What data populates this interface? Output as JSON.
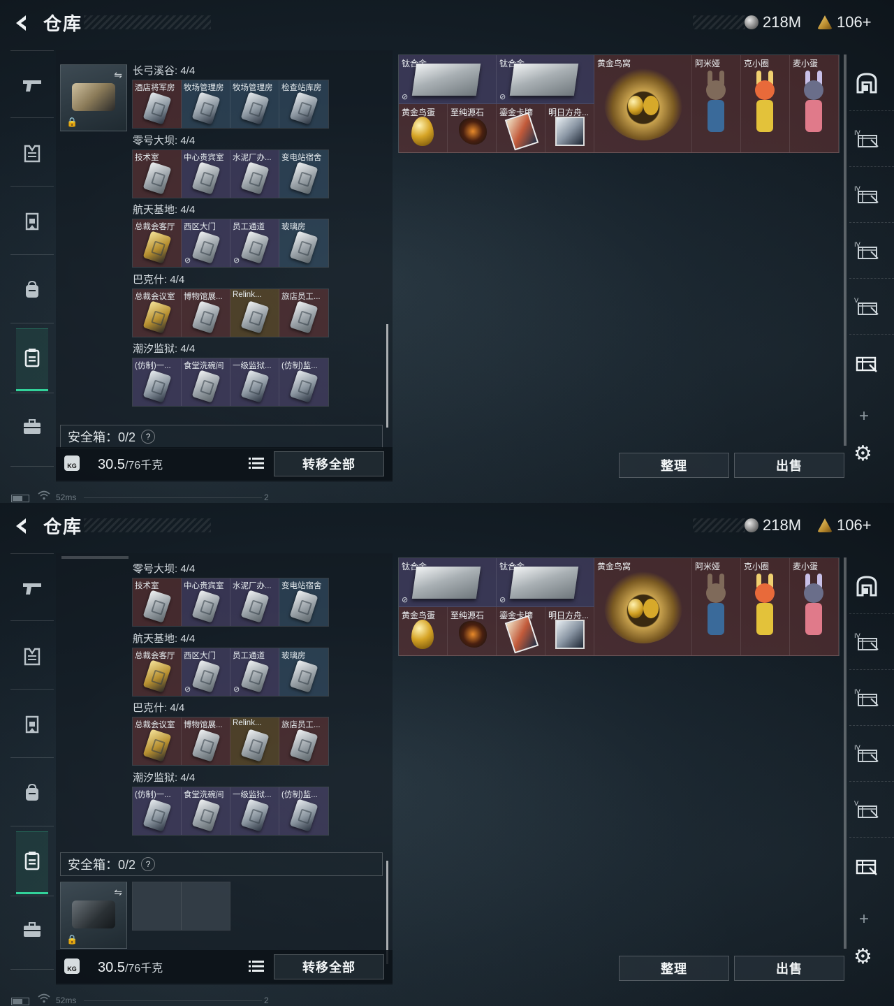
{
  "header": {
    "title": "仓库",
    "silver": "218M",
    "gold": "106+"
  },
  "nav": [
    "pistol-icon",
    "armor-icon",
    "chest-rig-icon",
    "backpack-icon",
    "keycard-case-icon",
    "briefcase-icon"
  ],
  "left": {
    "sections": [
      {
        "title": "长弓溪谷: 4/4",
        "cells": [
          {
            "label": "酒店将军房",
            "bg": "red",
            "key": "dark"
          },
          {
            "label": "牧场管理房",
            "bg": "blue",
            "key": "dark"
          },
          {
            "label": "牧场管理房",
            "bg": "blue",
            "key": "dark"
          },
          {
            "label": "检查站库房",
            "bg": "blue",
            "key": "dark"
          }
        ]
      },
      {
        "title": "零号大坝: 4/4",
        "cells": [
          {
            "label": "技术室",
            "bg": "red",
            "key": "normal"
          },
          {
            "label": "中心贵宾室",
            "bg": "purple",
            "key": "normal"
          },
          {
            "label": "水泥厂办...",
            "bg": "purple",
            "key": "normal"
          },
          {
            "label": "变电站宿舍",
            "bg": "blue",
            "key": "normal"
          }
        ]
      },
      {
        "title": "航天基地: 4/4",
        "cells": [
          {
            "label": "总裁会客厅",
            "bg": "red",
            "key": "gold"
          },
          {
            "label": "西区大门",
            "bg": "purple",
            "key": "normal",
            "nolink": true
          },
          {
            "label": "员工通道",
            "bg": "purple",
            "key": "normal",
            "nolink": true
          },
          {
            "label": "玻璃房",
            "bg": "blue",
            "key": "normal"
          }
        ]
      },
      {
        "title": "巴克什: 4/4",
        "cells": [
          {
            "label": "总裁会议室",
            "bg": "red",
            "key": "gold"
          },
          {
            "label": "博物馆展...",
            "bg": "red",
            "key": "normal"
          },
          {
            "label": "Relink...",
            "bg": "gold",
            "key": "normal"
          },
          {
            "label": "旅店员工...",
            "bg": "red",
            "key": "normal"
          }
        ]
      },
      {
        "title": "潮汐监狱: 4/4",
        "cells": [
          {
            "label": "(仿制)一...",
            "bg": "purple",
            "key": "dark"
          },
          {
            "label": "食堂洗碗间",
            "bg": "purple",
            "key": "normal"
          },
          {
            "label": "一级监狱...",
            "bg": "purple",
            "key": "dark"
          },
          {
            "label": "(仿制)监...",
            "bg": "purple",
            "key": "dark"
          }
        ]
      }
    ],
    "safebox_label": "安全箱：0/2",
    "qmark": "?",
    "weight": "30.5",
    "weight_cap": "/76千克",
    "kg": "KG",
    "transfer_all": "转移全部"
  },
  "right": {
    "items": {
      "ti1": "钛合金",
      "ti2": "钛合金",
      "nest": "黄金鸟窝",
      "amiya": "阿米娅",
      "kexq": "克小圈",
      "maixd": "麦小蛋",
      "egg": "黄金鸟蛋",
      "stone": "至纯源石",
      "card": "鎏金卡牌",
      "book": "明日方舟..."
    },
    "sort": "整理",
    "sell": "出售",
    "side_labels": [
      "IV",
      "IV",
      "IV",
      "V"
    ],
    "plus": "+",
    "gear": "⚙"
  },
  "status": {
    "ping": "52ms",
    "num": "2"
  },
  "colors": {
    "accent": "#32d29a"
  }
}
